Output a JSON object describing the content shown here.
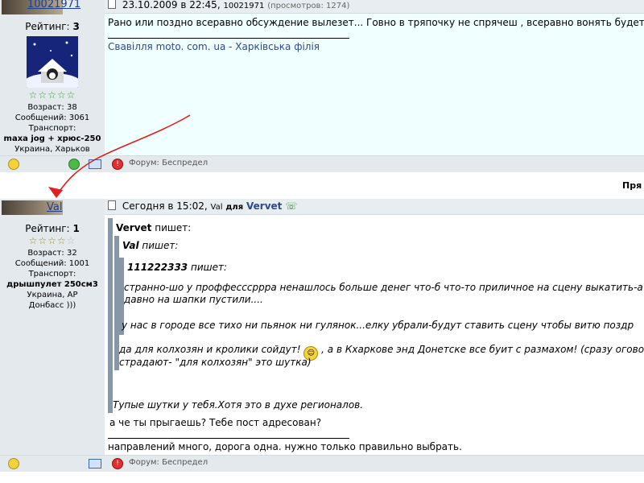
{
  "post1": {
    "author": "10021971",
    "rating_label": "Рейтинг:",
    "rating_value": "3",
    "stars": "☆☆☆☆☆",
    "age": "Возраст: 38",
    "messages": "Сообщений: 3061",
    "transport_label": "Транспорт:",
    "transport": "maxa jog + хрюс-250",
    "location": "Украина, Харьков",
    "date": "23.10.2009 в 22:45,",
    "date_author": "10021971",
    "views": "(просмотров: 1274)",
    "text": "Рано или поздно всеравно обсуждение вылезет... Говно в тряпочку не спрячеш , всеравно вонять будет!",
    "signature": "Свавілля moto. com. ua - Харківська філія",
    "forum": "Форум: Беспредел"
  },
  "divider_text": "Пря",
  "post2": {
    "author": "Val",
    "rating_label": "Рейтинг:",
    "rating_value": "1",
    "stars_filled": "☆☆☆☆",
    "stars_empty": "☆",
    "age": "Возраст: 32",
    "messages": "Сообщений: 1001",
    "transport_label": "Транспорт:",
    "transport": "дрышпулет 250см3",
    "location1": "Украина, АР",
    "location2": "Донбасс )))",
    "date": "Сегодня в 15:02,",
    "date_author": "Val",
    "for_label": "для",
    "for_user": "Vervet",
    "quote1_author": "Vervet",
    "quote1_says": "пишет:",
    "quote2_author": "Val",
    "quote2_says": "пишет:",
    "quote3_author": "111222333",
    "quote3_says": "пишет:",
    "q3_line1": "странно-шо у проффесссррра ненашлось больше денег что-б что-то приличное на сцену выкатить-а",
    "q3_line2": "давно на шапки пустили....",
    "q3_line3": "у нас в городе все тихо ни пьянок ни гулянок...елку убрали-будут ставить сцену чтобы витю поздр",
    "q2_line1a": "да для колхозян и кролики сойдут!",
    "q2_line1b": ", а в Кхаркове энд Донетске все буит с размахом! (сразу оговор",
    "q2_line2": "страдают- \"для колхозян\" это шутка)",
    "q1_text": "Тупые шутки у тебя.Хотя это в духе регионалов.",
    "reply": "а че ты прыгаешь? Тебе пост адресован?",
    "signature": "направлений много, дорога одна. нужно только правильно выбрать.",
    "forum": "Форум: Беспредел"
  },
  "colors": {
    "content_bg": "#f0ffff",
    "sidebar_bg": "#e4e9ee",
    "quote_bar": "#8797a7",
    "arrow": "#e02020"
  },
  "icons": [
    "lightbulb-icon",
    "flower-icon",
    "mail-icon",
    "warning-icon",
    "doc-icon",
    "phone-icon",
    "smiley-icon",
    "mascot-icon"
  ]
}
